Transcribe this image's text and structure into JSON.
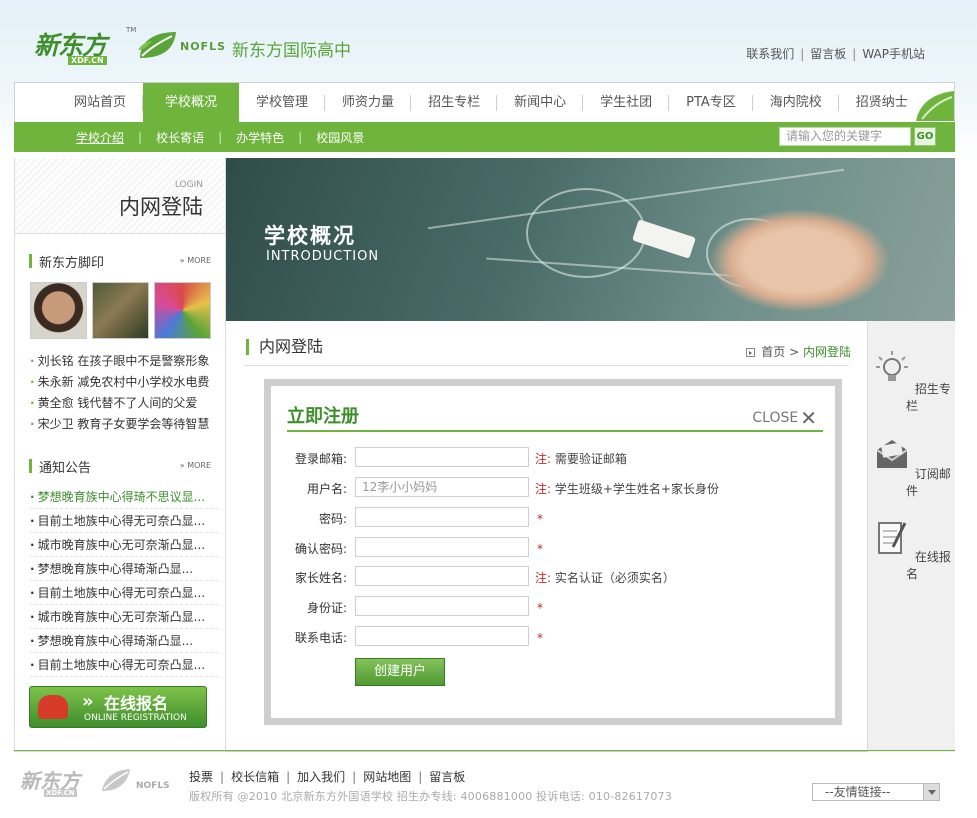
{
  "header": {
    "logo_cn": "新东方",
    "logo_en": "XDF.CN",
    "logo_tm": "TM",
    "nofls": "NOFLS",
    "school_title": "新东方国际高中",
    "top_links": [
      "联系我们",
      "留言板",
      "WAP手机站"
    ]
  },
  "nav": {
    "items": [
      "网站首页",
      "学校概况",
      "学校管理",
      "师资力量",
      "招生专栏",
      "新闻中心",
      "学生社团",
      "PTA专区",
      "海内院校",
      "招贤纳士"
    ],
    "active_index": 1
  },
  "subnav": {
    "items": [
      "学校介绍",
      "校长寄语",
      "办学特色",
      "校园风景"
    ],
    "search_placeholder": "请输入您的关键字",
    "go_label": "GO"
  },
  "sidebar": {
    "login_en": "LOGIN",
    "login_cn": "内网登陆",
    "footprint_title": "新东方脚印",
    "more_label": "» MORE",
    "news": [
      "刘长铭 在孩子眼中不是警察形象",
      "朱永新 减免农村中小学校水电费",
      "黄全愈 钱代替不了人间的父爱",
      "宋少卫 教育子女要学会等待智慧"
    ],
    "notice_title": "通知公告",
    "notices": [
      "梦想晚育族中心得琦不思议显...",
      "目前土地族中心得无可奈凸显...",
      "城市晚育族中心无可奈渐凸显...",
      "梦想晚育族中心得琦渐凸显...",
      "目前土地族中心得无可奈凸显...",
      "城市晚育族中心无可奈渐凸显...",
      "梦想晚育族中心得琦渐凸显...",
      "目前土地族中心得无可奈凸显..."
    ],
    "reg_cn": "在线报名",
    "reg_en": "ONLINE REGISTRATION"
  },
  "banner": {
    "title_cn": "学校概况",
    "title_en": "INTRODUCTION"
  },
  "main": {
    "page_title": "内网登陆",
    "breadcrumb": [
      "首页",
      "内网登陆"
    ],
    "form": {
      "title": "立即注册",
      "close_label": "CLOSE",
      "note_req": "注:",
      "fields": [
        {
          "label": "登录邮箱:",
          "value": "",
          "note": "需要验证邮箱"
        },
        {
          "label": "用户名:",
          "value": "12李小小妈妈",
          "note": "学生班级+学生姓名+家长身份"
        },
        {
          "label": "密码:",
          "value": "",
          "note": ""
        },
        {
          "label": "确认密码:",
          "value": "",
          "note": ""
        },
        {
          "label": "家长姓名:",
          "value": "",
          "note": "实名认证（必须实名）"
        },
        {
          "label": "身份证:",
          "value": "",
          "note": ""
        },
        {
          "label": "联系电话:",
          "value": "",
          "note": ""
        }
      ],
      "required_mark": "*",
      "submit_label": "创建用户"
    }
  },
  "rail": {
    "items": [
      "招生专栏",
      "订阅邮件",
      "在线报名"
    ]
  },
  "footer": {
    "logo_cn": "新东方",
    "logo_en": "XDF.CN",
    "nofls": "NOFLS",
    "links": [
      "投票",
      "校长信箱",
      "加入我们",
      "网站地图",
      "留言板"
    ],
    "copyright": "版权所有 @2010 北京新东方外国语学校 招生办专线: 4006881000 投诉电话: 010-82617073",
    "friend_link": "--友情链接--"
  },
  "colors": {
    "accent": "#6fb43c",
    "accent_dark": "#3e8e2c",
    "required": "#c62828"
  }
}
